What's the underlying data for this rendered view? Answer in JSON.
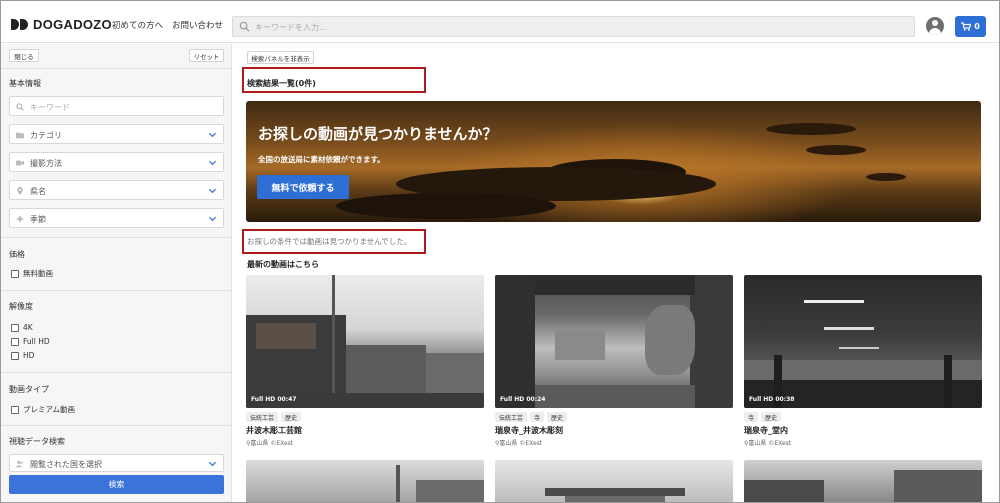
{
  "header": {
    "logo_text": "DOGADOZO",
    "nav": [
      "初めての方へ",
      "お問い合わせ"
    ],
    "search_placeholder": "キーワードを入力...",
    "cart_count": "0"
  },
  "sidebar": {
    "close_label": "閉じる",
    "reset_label": "リセット",
    "basic_info_title": "基本情報",
    "keyword_placeholder": "キーワード",
    "selects": [
      "カテゴリ",
      "撮影方法",
      "県名",
      "季節"
    ],
    "price_title": "価格",
    "price_options": [
      "無料動画"
    ],
    "resolution_title": "解像度",
    "resolution_options": [
      "4K",
      "Full HD",
      "HD"
    ],
    "video_type_title": "動画タイプ",
    "video_type_options": [
      "プレミアム動画"
    ],
    "view_data_title": "視聴データ検索",
    "view_data_select": "閲覧された国を選択",
    "search_button": "検索"
  },
  "main": {
    "toggle_panel_label": "検索パネルを非表示",
    "results_title": "検索結果一覧(0件)",
    "banner": {
      "title": "お探しの動画が見つかりませんか？",
      "subtitle": "全国の放送局に素材依頼ができます。",
      "button": "無料で依頼する"
    },
    "no_result_text": "お探しの条件では動画は見つかりませんでした。",
    "latest_title": "最新の動画はこちら",
    "cards": [
      {
        "meta": "Full HD 00:47",
        "tags": [
          "伝統工芸",
          "歴史"
        ],
        "title": "井波木彫工芸館",
        "sub": "富山県 ©EXest"
      },
      {
        "meta": "Full HD 00:24",
        "tags": [
          "伝統工芸",
          "寺",
          "歴史"
        ],
        "title": "瑞泉寺_井波木彫刻",
        "sub": "富山県 ©EXest"
      },
      {
        "meta": "Full HD 00:38",
        "tags": [
          "寺",
          "歴史"
        ],
        "title": "瑞泉寺_堂内",
        "sub": "富山県 ©EXest"
      }
    ]
  },
  "colors": {
    "primary_blue": "#2e6fd6",
    "highlight_red": "#b01a1a"
  }
}
